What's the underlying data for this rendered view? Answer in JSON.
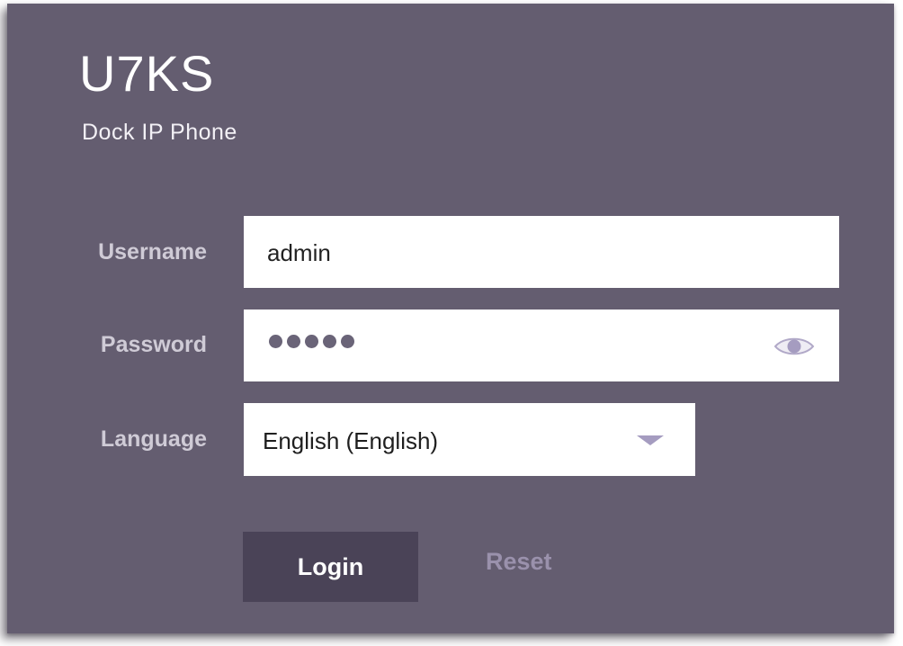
{
  "product": {
    "model": "U7KS",
    "subtitle": "Dock IP Phone"
  },
  "form": {
    "username": {
      "label": "Username",
      "value": "admin"
    },
    "password": {
      "label": "Password",
      "masked_length": 5,
      "toggle_icon": "eye-icon"
    },
    "language": {
      "label": "Language",
      "selected": "English (English)",
      "dropdown_icon": "chevron-down-icon"
    }
  },
  "actions": {
    "login_label": "Login",
    "reset_label": "Reset"
  },
  "colors": {
    "panel_background": "#645d70",
    "label_text": "#cfcbd6",
    "login_button": "#4a4357",
    "reset_text": "#9a91ac",
    "icon_accent": "#a59cc0"
  }
}
